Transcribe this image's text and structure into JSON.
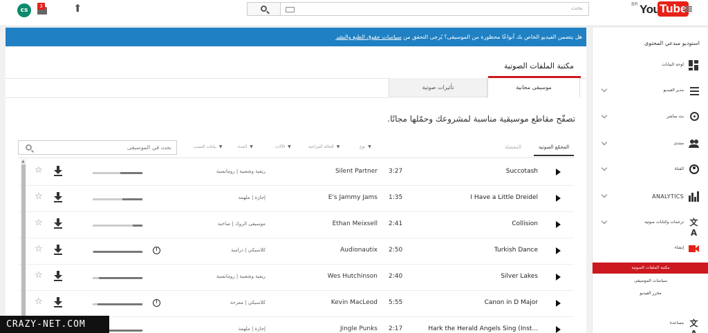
{
  "topbar": {
    "avatar_text": "cs",
    "notification_count": "3",
    "search_placeholder": "بحث",
    "logo_you": "You",
    "logo_tube": "Tube",
    "logo_country": "BR"
  },
  "banner": {
    "prefix": "هل يتضمن الفيديو الخاص بك أنواعًا محظورة من الموسيقى؟ يُرجى التحقق من ",
    "link": "سياسات حقوق الطبع والنشر"
  },
  "main": {
    "title": "مكتبة الملفات الصوتية",
    "tabs": [
      "موسيقى مجانية",
      "تأثيرات صوتية"
    ],
    "subtitle": "تصفّح مقاطع موسيقية مناسبة لمشروعك وحمّلها مجانًا.",
    "search_placeholder": "بحث في الموسيقى",
    "filter_tabs": [
      "المجمّع الصوتية",
      "المفضلة"
    ],
    "filters": [
      "نوع",
      "الحالة المزاجية",
      "الآلات",
      "المدة",
      "بيانات النسب"
    ]
  },
  "tracks": [
    {
      "title": "Succotash",
      "duration": "3:27",
      "artist": "Silent Partner",
      "genre": "ريفية وشعبية | رومانسية",
      "attribution": false,
      "popularity": 0.45
    },
    {
      "title": "I Have a Little Dreidel",
      "duration": "1:35",
      "artist": "E's Jammy Jams",
      "genre": "إجازة | ملهمة",
      "attribution": false,
      "popularity": 0.4
    },
    {
      "title": "Collision",
      "duration": "2:41",
      "artist": "Ethan Meixsell",
      "genre": "موسيقى الروك | صاخبة",
      "attribution": false,
      "popularity": 0.2
    },
    {
      "title": "Turkish Dance",
      "duration": "2:50",
      "artist": "Audionautix",
      "genre": "كلاسيكي | درامية",
      "attribution": true,
      "popularity": 0.98
    },
    {
      "title": "Silver Lakes",
      "duration": "2:40",
      "artist": "Wes Hutchinson",
      "genre": "ريفية وشعبية | رومانسية",
      "attribution": false,
      "popularity": 0.87
    },
    {
      "title": "Canon in D Major",
      "duration": "5:55",
      "artist": "Kevin MacLeod",
      "genre": "كلاسيكي | مفرحة",
      "attribution": true,
      "popularity": 0.9
    },
    {
      "title": "Hark the Herald Angels Sing (Inst...",
      "duration": "2:17",
      "artist": "Jingle Punks",
      "genre": "إجازة | ملهمة",
      "attribution": false,
      "popularity": 0.92
    }
  ],
  "sidebar": {
    "title": "استوديو مبدعي المحتوى",
    "items": [
      {
        "label": "لوحة البيانات",
        "icon": "dashboard-icon"
      },
      {
        "label": "مدير الفيديو",
        "icon": "video-list-icon"
      },
      {
        "label": "بث مباشر",
        "icon": "live-broadcast-icon"
      },
      {
        "label": "منتدى",
        "icon": "community-icon"
      },
      {
        "label": "القناة",
        "icon": "channel-person-icon"
      },
      {
        "label": "ANALYTICS",
        "icon": "analytics-icon"
      },
      {
        "label": "ترجمات وكتابات صوتية",
        "icon": "translate-icon"
      },
      {
        "label": "إنشاء",
        "icon": "create-video-icon"
      }
    ],
    "sub_items": [
      "مكتبة الملفات الصوتية",
      "سياسات الموسيقى",
      "محرر الفيديو"
    ],
    "bottom_item": {
      "label": "مساعدة",
      "icon": "translate-icon"
    }
  },
  "watermark": "CRAZY-NET.COM",
  "colors": {
    "brand_red": "#e62117",
    "banner_blue": "#1f80c3",
    "active_red": "#cc181e"
  }
}
